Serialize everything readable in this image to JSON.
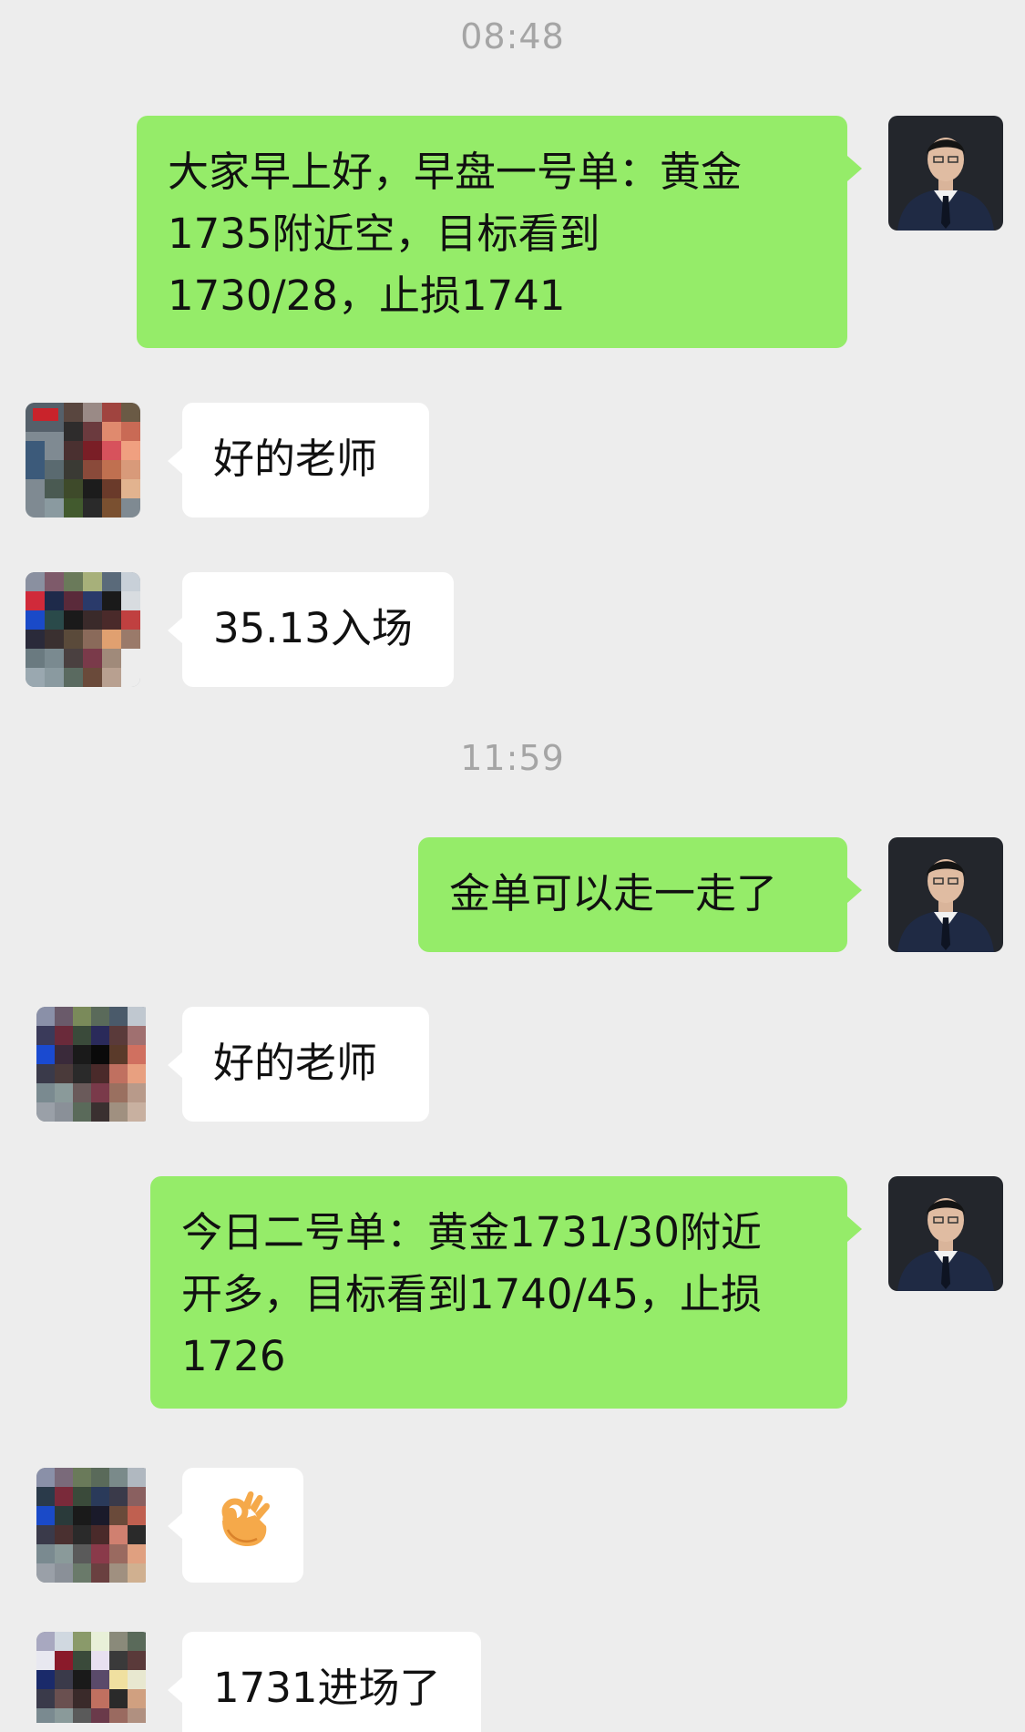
{
  "colors": {
    "background": "#ededed",
    "outgoing_bubble": "#95ec69",
    "incoming_bubble": "#ffffff",
    "timestamp": "#a5a5a5"
  },
  "timestamps": [
    "08:48",
    "11:59"
  ],
  "messages": [
    {
      "direction": "out",
      "avatar": "teacher-avatar",
      "lines": [
        "大家早上好，早盘一号单：黄金",
        "1735附近空，目标看到",
        "1730/28，止损1741"
      ]
    },
    {
      "direction": "in",
      "avatar": "member-avatar",
      "text": "好的老师"
    },
    {
      "direction": "in",
      "avatar": "member-avatar",
      "text": "35.13入场"
    },
    {
      "direction": "out",
      "avatar": "teacher-avatar",
      "text": "金单可以走一走了"
    },
    {
      "direction": "in",
      "avatar": "member-avatar",
      "text": "好的老师"
    },
    {
      "direction": "out",
      "avatar": "teacher-avatar",
      "lines": [
        "今日二号单：黄金1731/30附近",
        "开多，目标看到1740/45，止损",
        "1726"
      ]
    },
    {
      "direction": "in",
      "avatar": "member-avatar",
      "icon": "ok-hand-icon"
    },
    {
      "direction": "in",
      "avatar": "member-avatar",
      "text": "1731进场了"
    }
  ]
}
